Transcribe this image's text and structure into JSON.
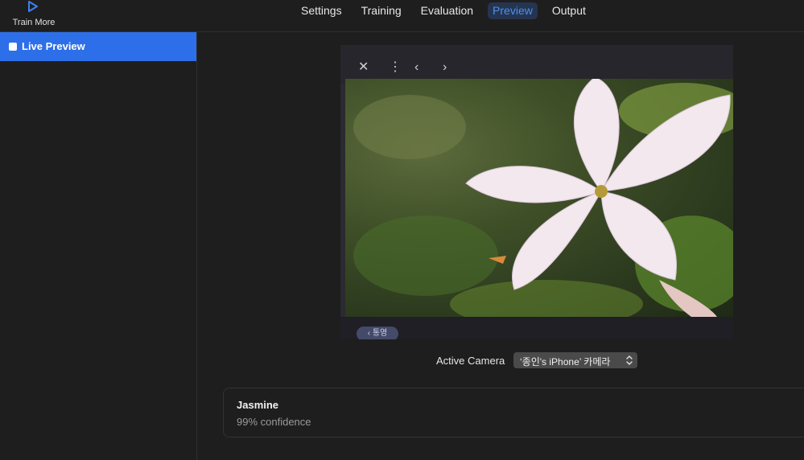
{
  "toolbar": {
    "train_more_label": "Train More",
    "train_more_icon": "play-icon",
    "tabs": [
      {
        "label": "Settings"
      },
      {
        "label": "Training"
      },
      {
        "label": "Evaluation"
      },
      {
        "label": "Preview",
        "active": true
      },
      {
        "label": "Output"
      }
    ]
  },
  "sidebar": {
    "items": [
      {
        "label": "Live Preview",
        "selected": true
      }
    ]
  },
  "preview": {
    "toolbar_icons": [
      "close-icon",
      "more-vertical-icon",
      "chevron-left-icon",
      "chevron-right-icon"
    ],
    "bottom_pill_text": "‹ 통영"
  },
  "camera": {
    "label": "Active Camera",
    "selected": "‘종인's iPhone’ 카메라"
  },
  "result": {
    "class_name": "Jasmine",
    "confidence": "99% confidence"
  },
  "colors": {
    "accent": "#2d6fe8",
    "active_tab_text": "#4d8ff0",
    "background": "#1e1e1e"
  }
}
